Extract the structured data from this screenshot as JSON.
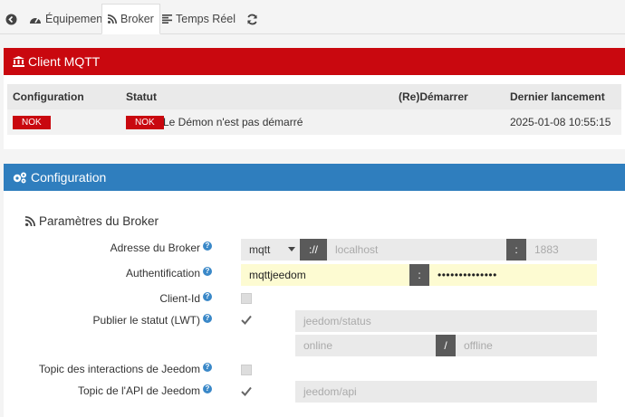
{
  "tabs": {
    "back_icon": "back-circle-icon",
    "equipement": "Équipement",
    "broker": "Broker",
    "temps_reel": "Temps Réel",
    "refresh_icon": "refresh-icon"
  },
  "client_panel": {
    "title": "Client MQTT",
    "headers": {
      "configuration": "Configuration",
      "statut": "Statut",
      "redemarrer": "(Re)Démarrer",
      "dernier": "Dernier lancement"
    },
    "row": {
      "config_badge": "NOK",
      "statut_badge": "NOK",
      "statut_text": "Le Démon n'est pas démarré",
      "dernier": "2025-01-08 10:55:15"
    }
  },
  "config_panel": {
    "title": "Configuration",
    "section_title": "Paramètres du Broker",
    "adresse": {
      "label": "Adresse du Broker",
      "protocol": "mqtt",
      "sep": "://",
      "host_placeholder": "localhost",
      "colon": ":",
      "port_placeholder": "1883"
    },
    "auth": {
      "label": "Authentification",
      "user": "mqttjeedom",
      "colon": ":",
      "password": "••••••••••••••"
    },
    "client_id": {
      "label": "Client-Id"
    },
    "lwt": {
      "label": "Publier le statut (LWT)",
      "topic_placeholder": "jeedom/status",
      "online_placeholder": "online",
      "slash": "/",
      "offline_placeholder": "offline"
    },
    "interactions": {
      "label": "Topic des interactions de Jeedom"
    },
    "api": {
      "label": "Topic de l'API de Jeedom",
      "topic_placeholder": "jeedom/api"
    },
    "help": "?"
  }
}
